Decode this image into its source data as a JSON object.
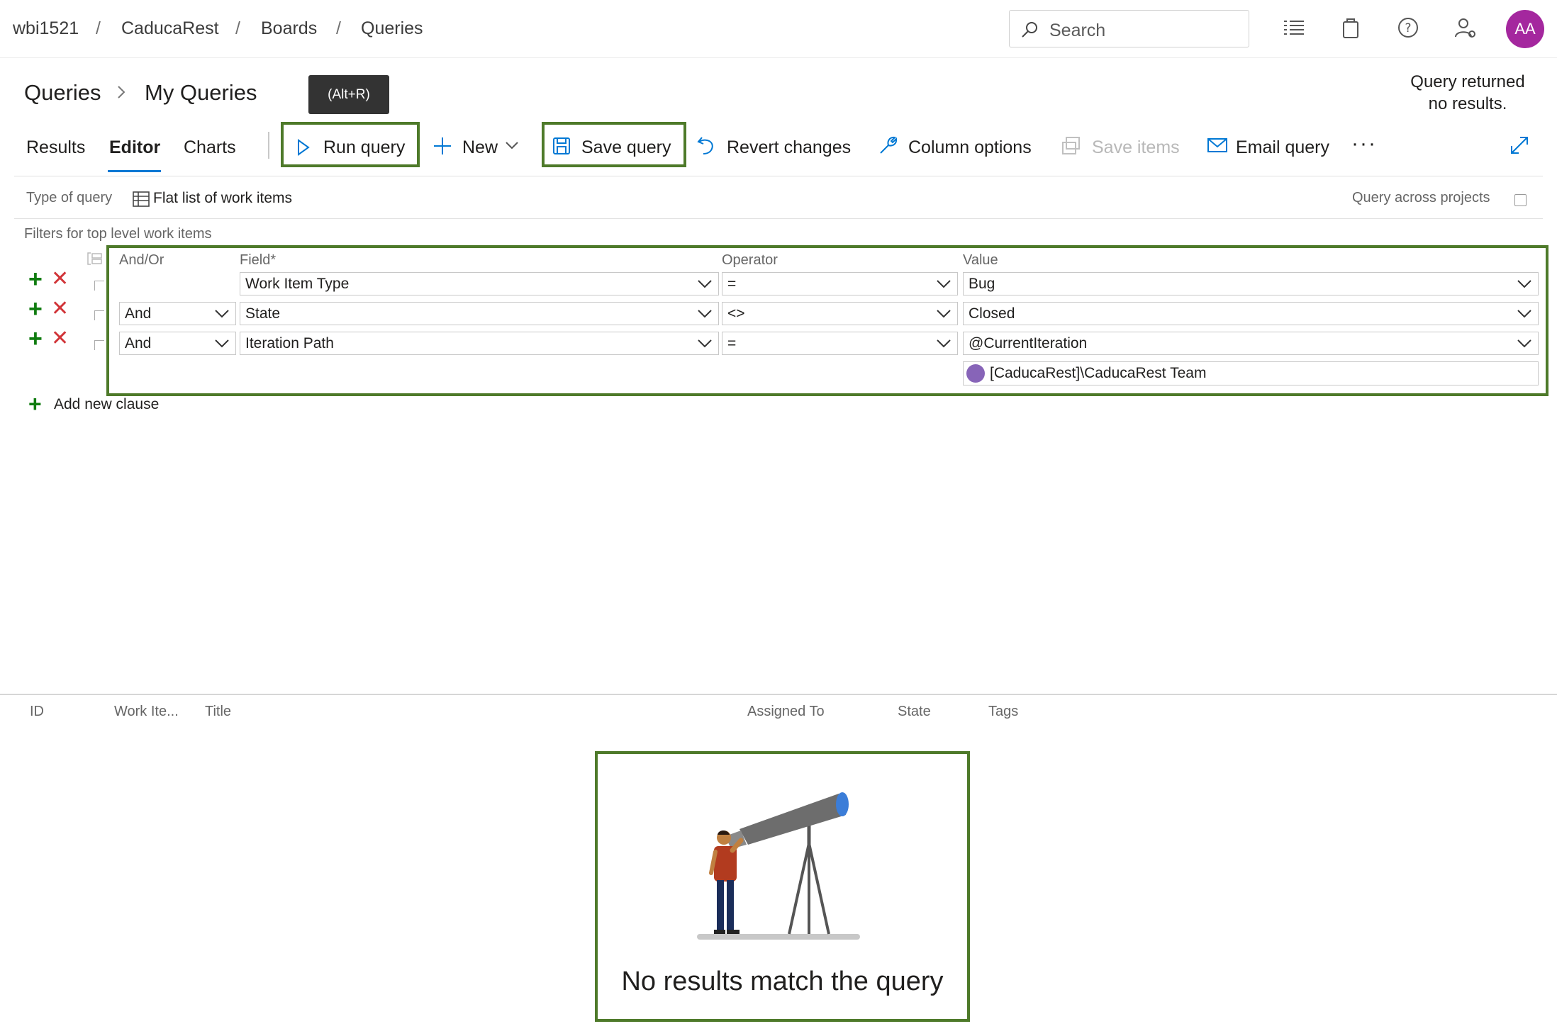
{
  "breadcrumb": {
    "items": [
      "wbi1521",
      "CaducaRest",
      "Boards",
      "Queries"
    ],
    "separator": "/"
  },
  "search": {
    "placeholder": "Search"
  },
  "user": {
    "initials": "AA",
    "avatar_color": "#a4279e"
  },
  "header": {
    "section": "Queries",
    "subsection": "My Queries",
    "tooltip": "(Alt+R)",
    "status_line1": "Query returned",
    "status_line2": "no results."
  },
  "tabs": [
    {
      "label": "Results",
      "active": false
    },
    {
      "label": "Editor",
      "active": true
    },
    {
      "label": "Charts",
      "active": false
    }
  ],
  "toolbar": {
    "run_query": "Run query",
    "new": "New",
    "save_query": "Save query",
    "revert_changes": "Revert changes",
    "column_options": "Column options",
    "save_items": "Save items",
    "email_query": "Email query",
    "more": "···"
  },
  "query_type": {
    "label": "Type of query",
    "value": "Flat list of work items",
    "across_projects_label": "Query across projects"
  },
  "filters": {
    "title": "Filters for top level work items",
    "columns": {
      "and_or": "And/Or",
      "field": "Field*",
      "operator": "Operator",
      "value": "Value"
    },
    "rows": [
      {
        "and_or": "",
        "field": "Work Item Type",
        "operator": "=",
        "value": "Bug"
      },
      {
        "and_or": "And",
        "field": "State",
        "operator": "<>",
        "value": "Closed"
      },
      {
        "and_or": "And",
        "field": "Iteration Path",
        "operator": "=",
        "value": "@CurrentIteration"
      }
    ],
    "team_value": "[CaducaRest]\\CaducaRest Team",
    "add_clause": "Add new clause"
  },
  "results": {
    "columns": [
      "ID",
      "Work Ite...",
      "Title",
      "Assigned To",
      "State",
      "Tags"
    ],
    "empty_message": "No results match the query"
  },
  "colors": {
    "accent": "#0078d4",
    "highlight_border": "#4e7a2a",
    "add_green": "#107c10",
    "delete_red": "#d13438"
  }
}
